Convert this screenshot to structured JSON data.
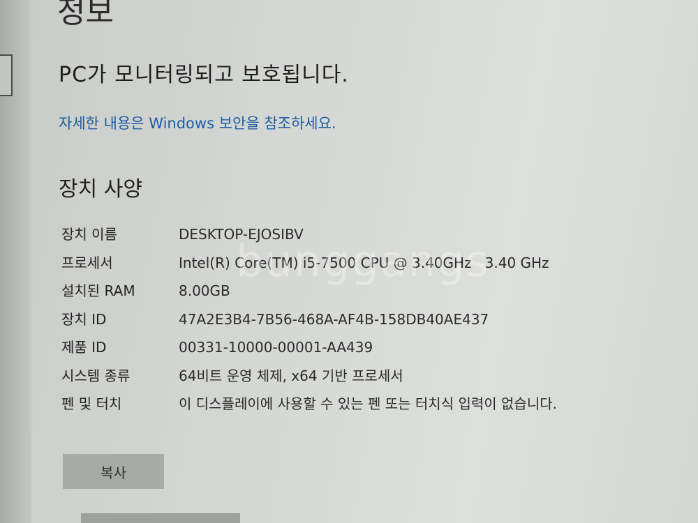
{
  "page": {
    "title": "정보",
    "status_heading": "PC가 모니터링되고 보호됩니다.",
    "security_link": "자세한 내용은 Windows 보안을 참조하세요."
  },
  "device_specs": {
    "heading": "장치 사양",
    "rows": [
      {
        "label": "장치 이름",
        "value": "DESKTOP-EJOSIBV"
      },
      {
        "label": "프로세서",
        "value": "Intel(R) Core(TM) i5-7500 CPU @ 3.40GHz   3.40 GHz"
      },
      {
        "label": "설치된 RAM",
        "value": "8.00GB"
      },
      {
        "label": "장치 ID",
        "value": "47A2E3B4-7B56-468A-AF4B-158DB40AE437"
      },
      {
        "label": "제품 ID",
        "value": "00331-10000-00001-AA439"
      },
      {
        "label": "시스템 종류",
        "value": "64비트 운영 체제, x64 기반 프로세서"
      },
      {
        "label": "펜 및 터치",
        "value": "이 디스플레이에 사용할 수 있는 펜 또는 터치식 입력이 없습니다."
      }
    ],
    "copy_label": "복사"
  },
  "watermark": "bunggangs"
}
